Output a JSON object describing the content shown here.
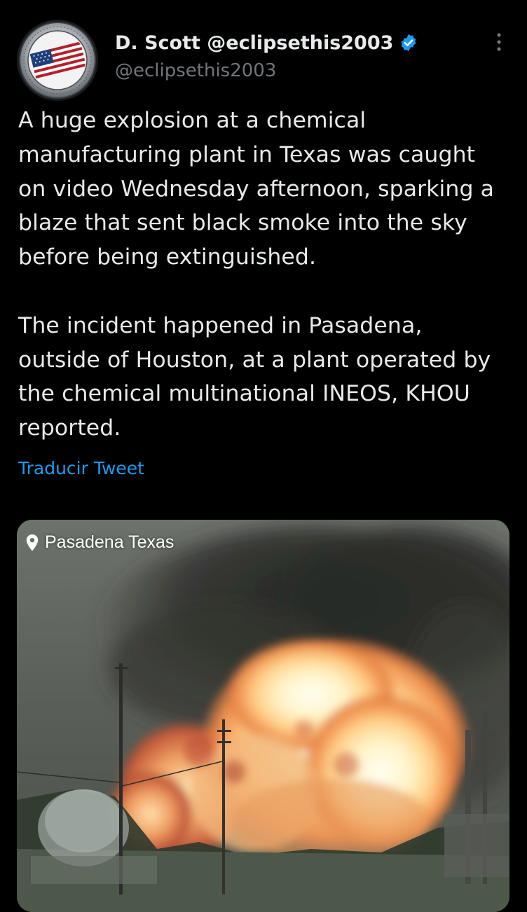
{
  "author": {
    "display_name": "D. Scott @eclipsethis2003",
    "handle": "@eclipsethis2003",
    "verified": true,
    "verified_color": "#1d9bf0",
    "avatar_icon": "flag-seal-avatar"
  },
  "more_icon": "more-options-icon",
  "tweet": {
    "text": "A huge explosion at a chemical manufacturing plant in Texas was caught on video Wednesday afternoon, sparking a blaze that sent black smoke into the sky before being extinguished.\n\nThe incident happened in Pasadena, outside of Houston, at a plant operated by the chemical multinational INEOS, KHOU reported.",
    "translate_label": "Traducir Tweet"
  },
  "media": {
    "type": "video-frame",
    "description_icon": "explosion-fireball",
    "location": "Pasadena Texas",
    "location_icon": "location-pin-icon"
  },
  "colors": {
    "background": "#000000",
    "text_primary": "#e7e9ea",
    "text_secondary": "#71767b",
    "link": "#1d9bf0"
  }
}
